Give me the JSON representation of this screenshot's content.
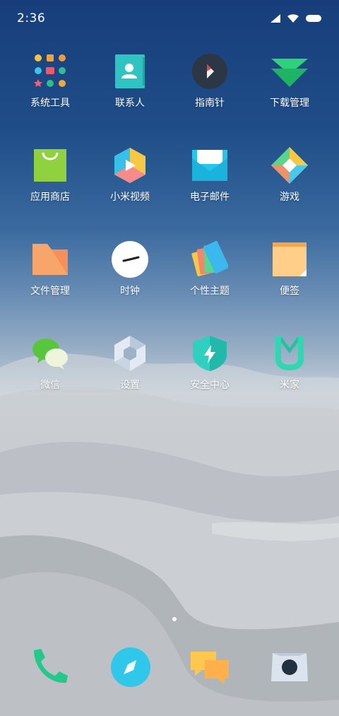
{
  "status_bar": {
    "time": "2:36"
  },
  "apps": [
    {
      "name": "系统工具",
      "icon": "system-tools-folder-icon"
    },
    {
      "name": "联系人",
      "icon": "contacts-icon"
    },
    {
      "name": "指南针",
      "icon": "compass-icon"
    },
    {
      "name": "下载管理",
      "icon": "download-manager-icon"
    },
    {
      "name": "应用商店",
      "icon": "app-store-icon"
    },
    {
      "name": "小米视频",
      "icon": "mi-video-icon"
    },
    {
      "name": "电子邮件",
      "icon": "email-icon"
    },
    {
      "name": "游戏",
      "icon": "games-icon"
    },
    {
      "name": "文件管理",
      "icon": "file-manager-icon"
    },
    {
      "name": "时钟",
      "icon": "clock-icon"
    },
    {
      "name": "个性主题",
      "icon": "themes-icon"
    },
    {
      "name": "便签",
      "icon": "notes-icon"
    },
    {
      "name": "微信",
      "icon": "wechat-icon"
    },
    {
      "name": "设置",
      "icon": "settings-icon"
    },
    {
      "name": "安全中心",
      "icon": "security-icon"
    },
    {
      "name": "米家",
      "icon": "mi-home-icon"
    }
  ],
  "dock": [
    {
      "icon": "phone-icon"
    },
    {
      "icon": "browser-icon"
    },
    {
      "icon": "messages-icon"
    },
    {
      "icon": "camera-icon"
    }
  ],
  "pages": {
    "current": 1,
    "total": 1
  }
}
